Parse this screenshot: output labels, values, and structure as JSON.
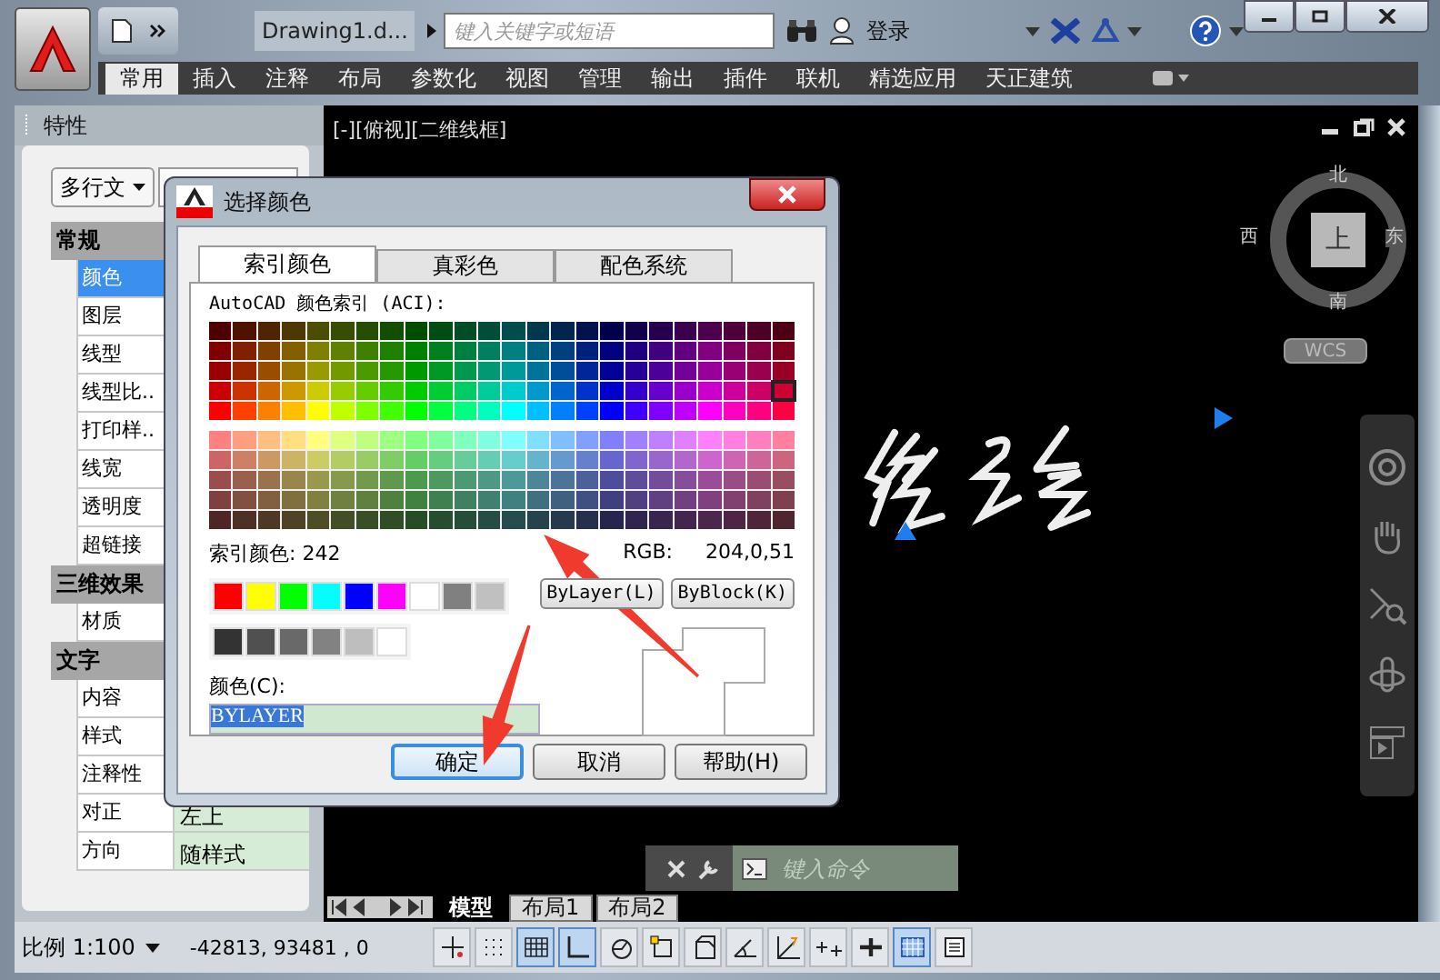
{
  "title_bar": {
    "document_title": "Drawing1.d...",
    "search": {
      "placeholder": "键入关键字或短语"
    },
    "sign_in": "登录"
  },
  "ribbon_tabs": [
    {
      "label": "常用",
      "selected": true
    },
    {
      "label": "插入",
      "selected": false
    },
    {
      "label": "注释",
      "selected": false
    },
    {
      "label": "布局",
      "selected": false
    },
    {
      "label": "参数化",
      "selected": false
    },
    {
      "label": "视图",
      "selected": false
    },
    {
      "label": "管理",
      "selected": false
    },
    {
      "label": "输出",
      "selected": false
    },
    {
      "label": "插件",
      "selected": false
    },
    {
      "label": "联机",
      "selected": false
    },
    {
      "label": "精选应用",
      "selected": false
    },
    {
      "label": "天正建筑",
      "selected": false
    }
  ],
  "properties_panel": {
    "title": "特性",
    "object_type": "多行文",
    "sections": [
      {
        "title": "常规",
        "rows": [
          {
            "name": "颜色",
            "selected": true
          },
          {
            "name": "图层",
            "selected": false
          },
          {
            "name": "线型",
            "selected": false
          },
          {
            "name": "线型比..",
            "selected": false
          },
          {
            "name": "打印样..",
            "selected": false
          },
          {
            "name": "线宽",
            "selected": false
          },
          {
            "name": "透明度",
            "selected": false
          },
          {
            "name": "超链接",
            "selected": false
          }
        ]
      },
      {
        "title": "三维效果",
        "rows": [
          {
            "name": "材质",
            "selected": false
          }
        ]
      },
      {
        "title": "文字",
        "rows": [
          {
            "name": "内容",
            "selected": false
          },
          {
            "name": "样式",
            "selected": false
          },
          {
            "name": "注释性",
            "selected": false
          },
          {
            "name": "对正",
            "value": "左上",
            "selected": false
          },
          {
            "name": "方向",
            "value": "随样式",
            "selected": false
          }
        ]
      }
    ]
  },
  "viewport": {
    "label": "[-][俯视][二维线框]",
    "viewcube": {
      "north": "北",
      "west": "西",
      "east": "东",
      "south": "南",
      "face": "上"
    },
    "ucs": "WCS"
  },
  "command_line": {
    "placeholder": "键入命令"
  },
  "layout_tabs": [
    {
      "label": "模型",
      "selected": true
    },
    {
      "label": "布局1",
      "selected": false
    },
    {
      "label": "布局2",
      "selected": false
    }
  ],
  "status_bar": {
    "scale": "比例 1:100",
    "coordinates": "-42813, 93481 , 0",
    "toggles": [
      {
        "kind": "snap",
        "on": false
      },
      {
        "kind": "dots",
        "on": false
      },
      {
        "kind": "grid",
        "on": true
      },
      {
        "kind": "ortho",
        "on": true
      },
      {
        "kind": "polar",
        "on": false
      },
      {
        "kind": "osnap",
        "on": false
      },
      {
        "kind": "osnap3d",
        "on": false
      },
      {
        "kind": "otrack",
        "on": false
      },
      {
        "kind": "ducs",
        "on": false
      },
      {
        "kind": "dyn",
        "on": false
      },
      {
        "kind": "lwt",
        "on": false
      },
      {
        "kind": "tpy",
        "on": true
      },
      {
        "kind": "qp",
        "on": false
      }
    ]
  },
  "dialog": {
    "title": "选择颜色",
    "tabs": [
      {
        "label": "索引颜色",
        "selected": true
      },
      {
        "label": "真彩色",
        "selected": false
      },
      {
        "label": "配色系统",
        "selected": false
      }
    ],
    "aci_label": "AutoCAD 颜色索引 (ACI):",
    "index_label": "索引颜色:",
    "index_value": "242",
    "rgb_label": "RGB:",
    "rgb_value": "204,0,51",
    "bylayer_button": "ByLayer(L)",
    "byblock_button": "ByBlock(K)",
    "color_label": "颜色(C):",
    "color_value": "BYLAYER",
    "buttons": [
      {
        "label": "确定",
        "default": true
      },
      {
        "label": "取消",
        "default": false
      },
      {
        "label": "帮助(H)",
        "default": false
      }
    ]
  }
}
